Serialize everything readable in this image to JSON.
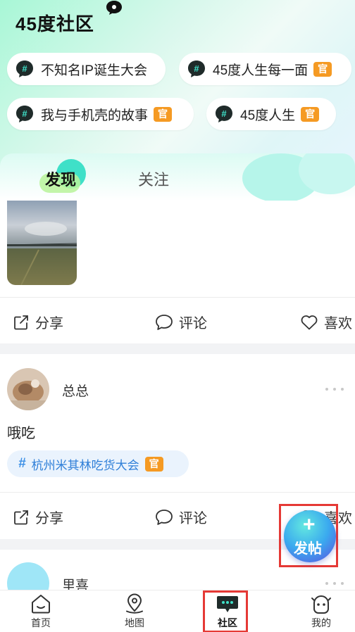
{
  "header": {
    "app_title": "45度社区"
  },
  "topics": [
    {
      "label": "不知名IP诞生大会",
      "official": false
    },
    {
      "label": "45度人生每一面",
      "official": true
    },
    {
      "label": "我与手机壳的故事",
      "official": true
    },
    {
      "label": "45度人生",
      "official": true
    }
  ],
  "official_badge": "官",
  "tabs": {
    "discover": "发现",
    "follow": "关注"
  },
  "actions": {
    "share": "分享",
    "comment": "评论",
    "like": "喜欢"
  },
  "posts": [
    {
      "username": "总总",
      "text": "哦吃",
      "topic": "杭州米其林吃货大会",
      "topic_official": true
    },
    {
      "username": "里喜"
    }
  ],
  "fab": {
    "plus": "+",
    "label": "发帖"
  },
  "bottom_nav": [
    {
      "label": "首页",
      "icon": "home-icon"
    },
    {
      "label": "地图",
      "icon": "map-pin-icon"
    },
    {
      "label": "社区",
      "icon": "chat-bubble-icon",
      "active": true
    },
    {
      "label": "我的",
      "icon": "profile-face-icon"
    }
  ],
  "colors": {
    "accent_teal": "#3fe0c8",
    "official_orange": "#f59a23",
    "topic_blue": "#2f7fd8",
    "highlight_red": "#e53935"
  }
}
